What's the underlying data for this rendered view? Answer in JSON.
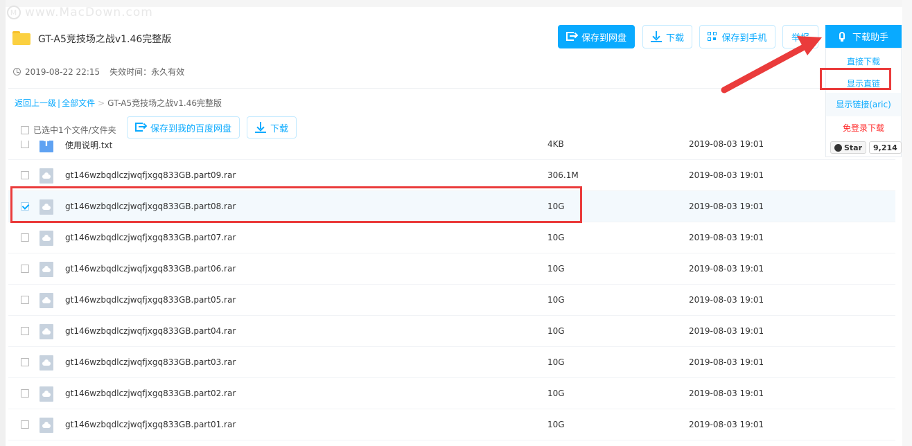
{
  "watermark": {
    "text": "www.MacDown.com",
    "logo_letter": "M"
  },
  "file": {
    "title": "GT-A5竞技场之战v1.46完整版",
    "date": "2019-08-22 22:15",
    "expire_label": "失效时间：永久有效"
  },
  "toolbar": {
    "save_to_disk": "保存到网盘",
    "download": "下载",
    "save_to_phone": "保存到手机",
    "report": "举报"
  },
  "helper": {
    "button_label": "下载助手",
    "menu": {
      "direct_download": "直接下载",
      "show_direct_link": "显示直链",
      "show_link_aric": "显示链接(aric)",
      "no_login_download": "免登录下载"
    },
    "github": {
      "star_label": "Star",
      "count": "9,214"
    }
  },
  "breadcrumb": {
    "back": "返回上一级",
    "separator": "|",
    "all_files": "全部文件",
    "arrow": ">",
    "current": "GT-A5竞技场之战v1.46完整版"
  },
  "selection": {
    "summary": "已选中1个文件/文件夹",
    "save_to_baidu": "保存到我的百度网盘",
    "download": "下载"
  },
  "files": [
    {
      "name": "使用说明.txt",
      "size": "4KB",
      "date": "2019-08-03 19:01",
      "checked": false,
      "type": "txt"
    },
    {
      "name": "gt146wzbqdlczjwqfjxgq833GB.part09.rar",
      "size": "306.1M",
      "date": "2019-08-03 19:01",
      "checked": false,
      "type": "rar"
    },
    {
      "name": "gt146wzbqdlczjwqfjxgq833GB.part08.rar",
      "size": "10G",
      "date": "2019-08-03 19:01",
      "checked": true,
      "type": "rar"
    },
    {
      "name": "gt146wzbqdlczjwqfjxgq833GB.part07.rar",
      "size": "10G",
      "date": "2019-08-03 19:01",
      "checked": false,
      "type": "rar"
    },
    {
      "name": "gt146wzbqdlczjwqfjxgq833GB.part06.rar",
      "size": "10G",
      "date": "2019-08-03 19:01",
      "checked": false,
      "type": "rar"
    },
    {
      "name": "gt146wzbqdlczjwqfjxgq833GB.part05.rar",
      "size": "10G",
      "date": "2019-08-03 19:01",
      "checked": false,
      "type": "rar"
    },
    {
      "name": "gt146wzbqdlczjwqfjxgq833GB.part04.rar",
      "size": "10G",
      "date": "2019-08-03 19:01",
      "checked": false,
      "type": "rar"
    },
    {
      "name": "gt146wzbqdlczjwqfjxgq833GB.part03.rar",
      "size": "10G",
      "date": "2019-08-03 19:01",
      "checked": false,
      "type": "rar"
    },
    {
      "name": "gt146wzbqdlczjwqfjxgq833GB.part02.rar",
      "size": "10G",
      "date": "2019-08-03 19:01",
      "checked": false,
      "type": "rar"
    },
    {
      "name": "gt146wzbqdlczjwqfjxgq833GB.part01.rar",
      "size": "10G",
      "date": "2019-08-03 19:01",
      "checked": false,
      "type": "rar"
    }
  ],
  "colors": {
    "accent": "#09aaff",
    "annotation_red": "#ea3b3b",
    "danger_text": "#ff2b2b"
  }
}
